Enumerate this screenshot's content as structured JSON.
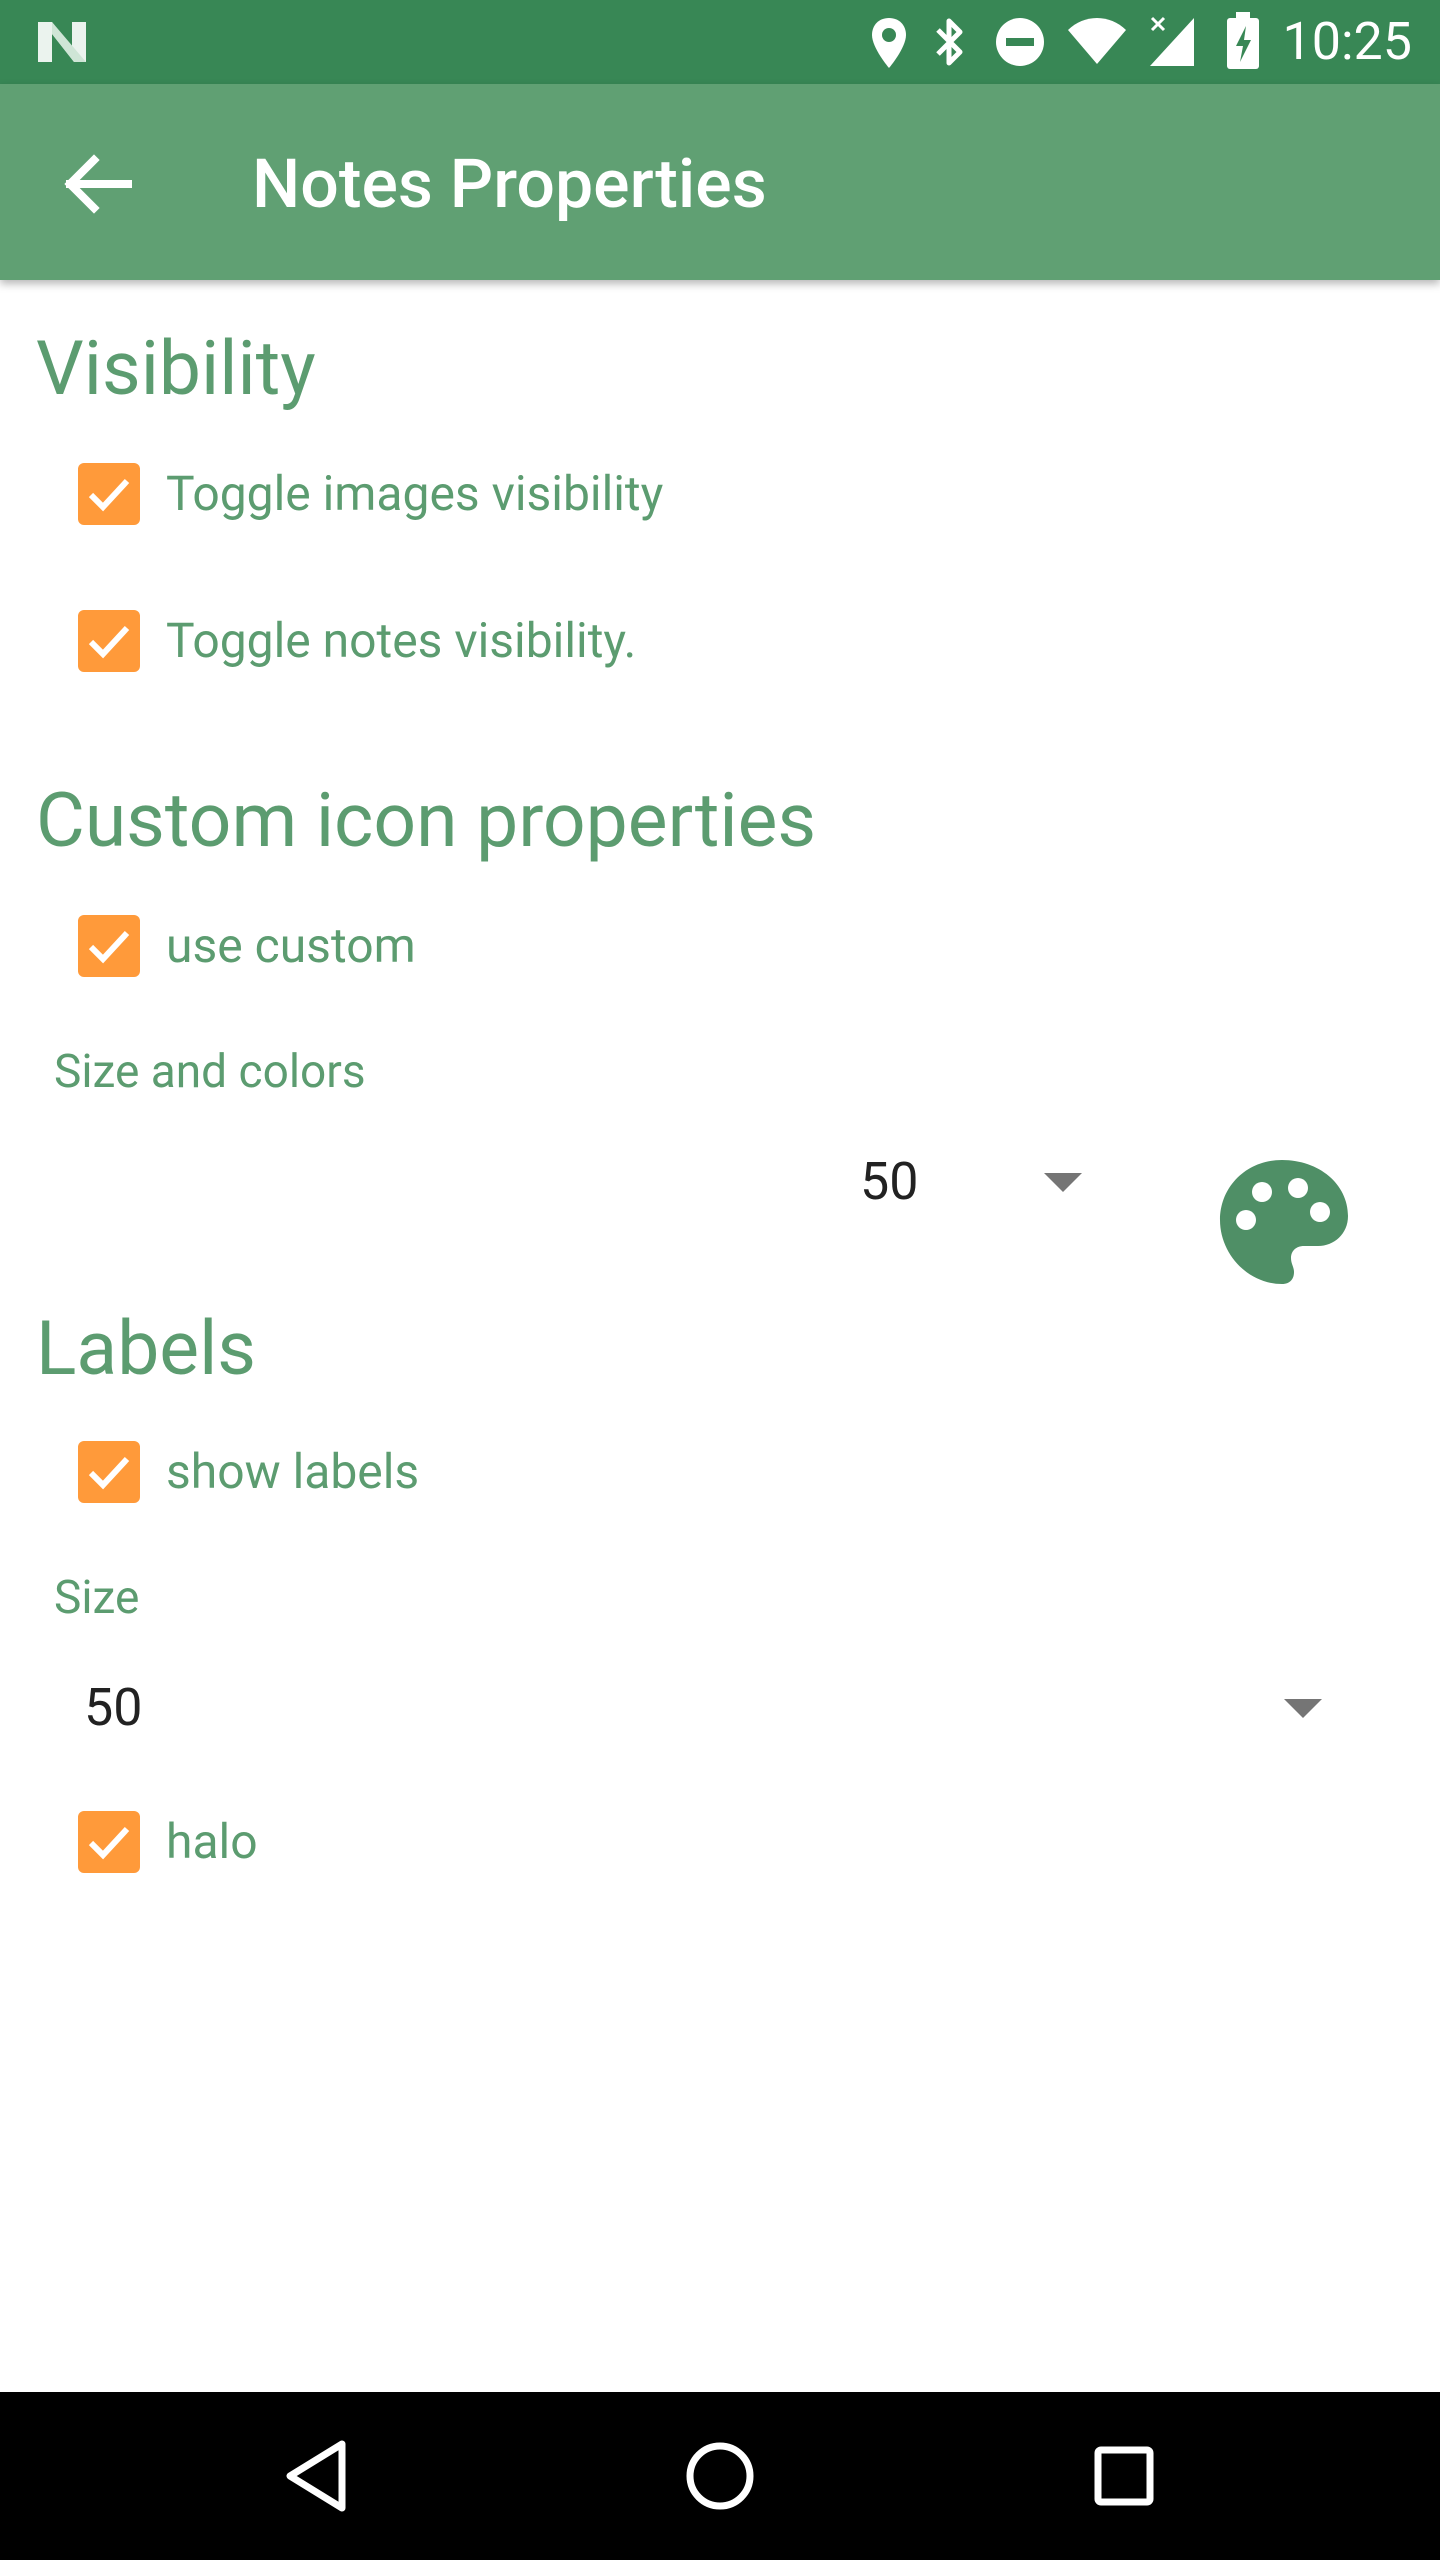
{
  "status_bar": {
    "time": "10:25",
    "icons": [
      "notification-n-icon",
      "location-icon",
      "bluetooth-icon",
      "do-not-disturb-icon",
      "wifi-icon",
      "cell-signal-icon",
      "battery-charging-icon"
    ]
  },
  "app_bar": {
    "title": "Notes Properties",
    "back_icon": "arrow-back-icon"
  },
  "visibility": {
    "title": "Visibility",
    "toggle_images": {
      "label": "Toggle images visibility",
      "checked": true
    },
    "toggle_notes": {
      "label": "Toggle notes visibility.",
      "checked": true
    }
  },
  "custom_icon": {
    "title": "Custom icon properties",
    "use_custom": {
      "label": "use custom",
      "checked": true
    },
    "size_colors_label": "Size and colors",
    "size_value": "50",
    "palette_icon": "palette-icon"
  },
  "labels": {
    "title": "Labels",
    "show_labels": {
      "label": "show labels",
      "checked": true
    },
    "size_label": "Size",
    "size_value": "50",
    "halo": {
      "label": "halo",
      "checked": true
    }
  },
  "nav_bar": {
    "icons": [
      "back-triangle-icon",
      "home-circle-icon",
      "recents-square-icon"
    ]
  },
  "colors": {
    "status_bar": "#388755",
    "app_bar": "#60a073",
    "accent_text": "#5c9c70",
    "checkbox": "#ff9a3a",
    "palette": "#4f8f66"
  }
}
